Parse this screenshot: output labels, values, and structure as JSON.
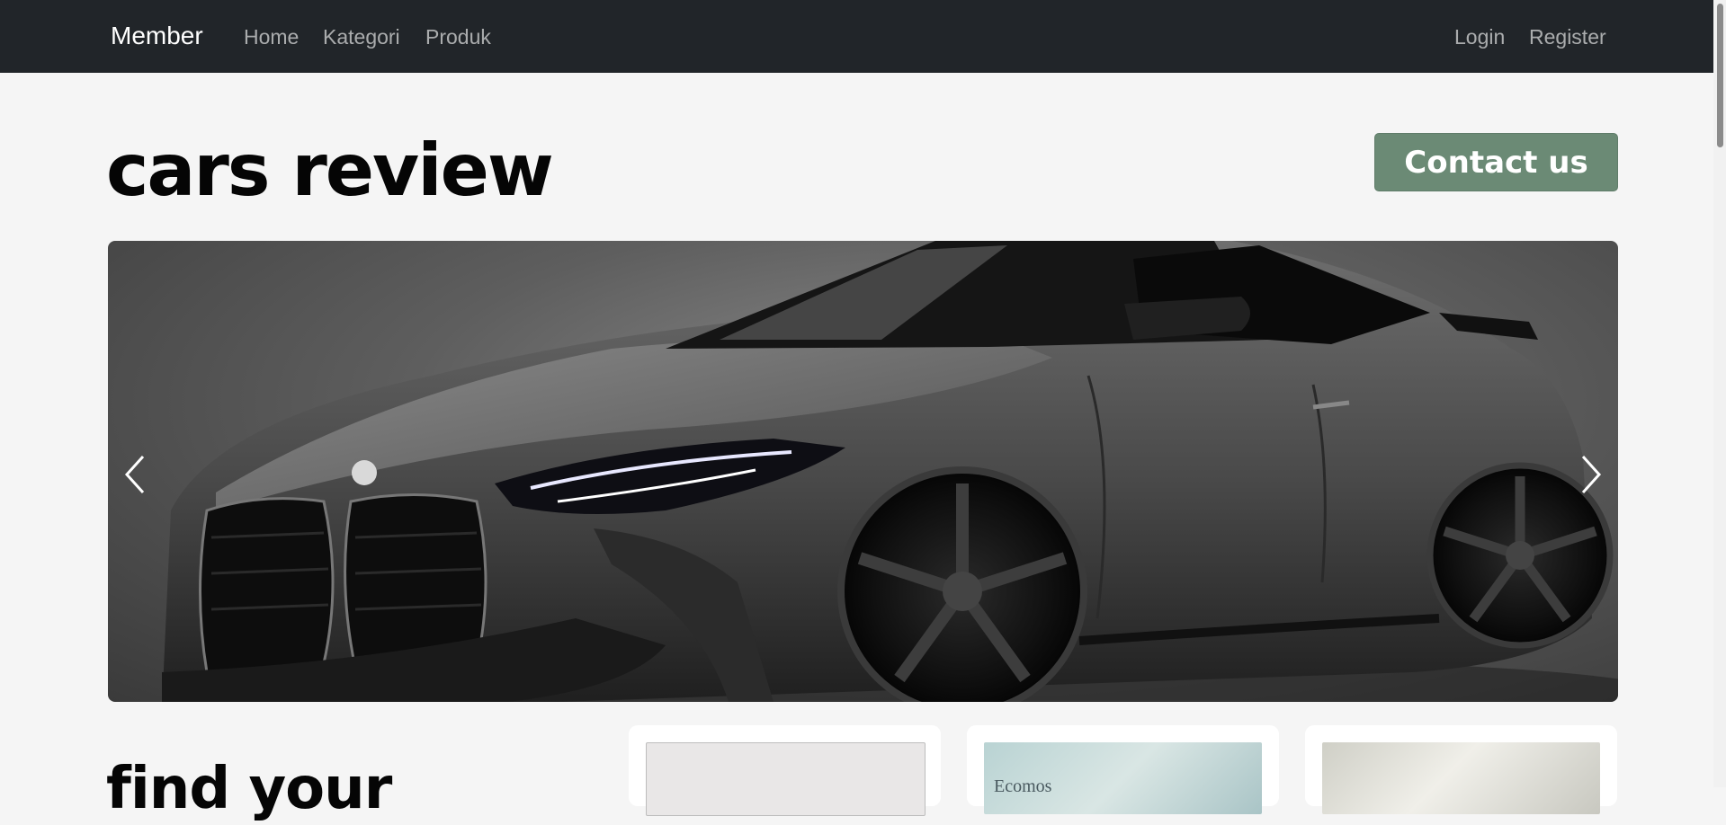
{
  "navbar": {
    "brand": "Member",
    "links": [
      "Home",
      "Kategori",
      "Produk"
    ],
    "auth": [
      "Login",
      "Register"
    ],
    "background": "#212529"
  },
  "header": {
    "title": "cars review",
    "contact_label": "Contact us",
    "accent": "#6b8a75"
  },
  "carousel": {
    "image": "car-photo",
    "prev_icon": "chevron-left-icon",
    "next_icon": "chevron-right-icon"
  },
  "section": {
    "heading": "find your",
    "card_text": "Ecomos"
  }
}
